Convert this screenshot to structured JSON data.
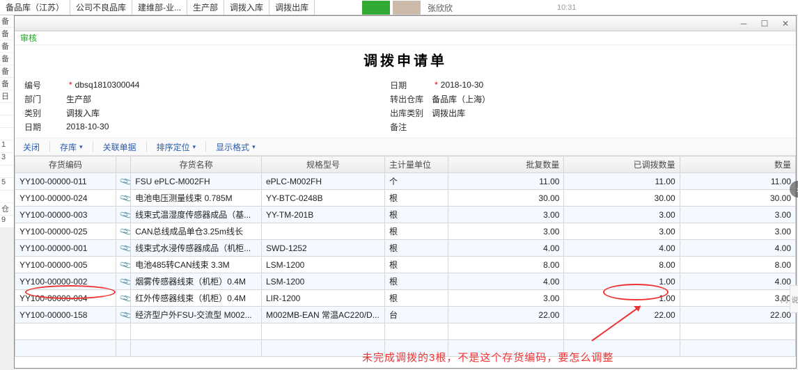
{
  "bg_tabs": [
    "备品库（江苏）",
    "公司不良品库",
    "建维部-业...",
    "生产部",
    "调拨入库",
    "调拨出库"
  ],
  "bg_contact_name": "张欣欣",
  "bg_time": "10:31",
  "side_snippets": [
    "备品",
    "备品",
    "备品",
    "备品",
    "备品",
    "备品",
    "日期",
    "",
    "",
    "",
    "1",
    "3",
    "",
    "5",
    "",
    "仓货",
    "9",
    ""
  ],
  "approve_label": "审核",
  "doc_title": "调拨申请单",
  "form": {
    "code_label": "编号",
    "code_value": "dbsq1810300044",
    "date_label": "日期",
    "date_value": "2018-10-30",
    "dept_label": "部门",
    "dept_value": "生产部",
    "out_wh_label": "转出仓库",
    "out_wh_value": "备品库（上海）",
    "in_cat_label": "类别",
    "in_cat_value": "调拨入库",
    "out_cat_label": "出库类别",
    "out_cat_value": "调拨出库",
    "trans_date_label": "日期",
    "trans_date_value": "2018-10-30",
    "remark_label": "备注",
    "remark_value": ""
  },
  "toolbar": {
    "close": "关闭",
    "stock": "存库",
    "rel": "关联单据",
    "sort": "排序定位",
    "format": "显示格式"
  },
  "columns": {
    "code": "存货编码",
    "name": "存货名称",
    "spec": "规格型号",
    "unit": "主计量单位",
    "approve_qty": "批复数量",
    "trans_qty": "已调拨数量",
    "qty": "数量"
  },
  "rows": [
    {
      "code": "YY100-00000-011",
      "name": "FSU ePLC-M002FH",
      "spec": "ePLC-M002FH",
      "unit": "个",
      "a": "11.00",
      "t": "11.00",
      "q": "11.00"
    },
    {
      "code": "YY100-00000-024",
      "name": "电池电压测量线束  0.785M",
      "spec": "YY-BTC-0248B",
      "unit": "根",
      "a": "30.00",
      "t": "30.00",
      "q": "30.00"
    },
    {
      "code": "YY100-00000-003",
      "name": "线束式温湿度传感器成品（基...",
      "spec": "YY-TM-201B",
      "unit": "根",
      "a": "3.00",
      "t": "3.00",
      "q": "3.00"
    },
    {
      "code": "YY100-00000-025",
      "name": "CAN总线成品单仓3.25m线长",
      "spec": "",
      "unit": "根",
      "a": "3.00",
      "t": "3.00",
      "q": "3.00"
    },
    {
      "code": "YY100-00000-001",
      "name": "线束式水浸传感器成品（机柜...",
      "spec": "SWD-1252",
      "unit": "根",
      "a": "4.00",
      "t": "4.00",
      "q": "4.00"
    },
    {
      "code": "YY100-00000-005",
      "name": "电池485转CAN线束  3.3M",
      "spec": "LSM-1200",
      "unit": "根",
      "a": "8.00",
      "t": "8.00",
      "q": "8.00"
    },
    {
      "code": "YY100-00000-002",
      "name": "烟雾传感器线束（机柜）0.4M",
      "spec": "LSM-1200",
      "unit": "根",
      "a": "4.00",
      "t": "1.00",
      "q": "4.00"
    },
    {
      "code": "YY100-00000-004",
      "name": "红外传感器线束（机柜）0.4M",
      "spec": "LIR-1200",
      "unit": "根",
      "a": "3.00",
      "t": "1.00",
      "q": "3.00"
    },
    {
      "code": "YY100-00000-158",
      "name": "经济型户外FSU-交流型 M002...",
      "spec": "M002MB-EAN 常温AC220/D...",
      "unit": "台",
      "a": "22.00",
      "t": "22.00",
      "q": "22.00"
    }
  ],
  "annotation": "未完成调拨的3根，不是这个存货编码，要怎么调整"
}
